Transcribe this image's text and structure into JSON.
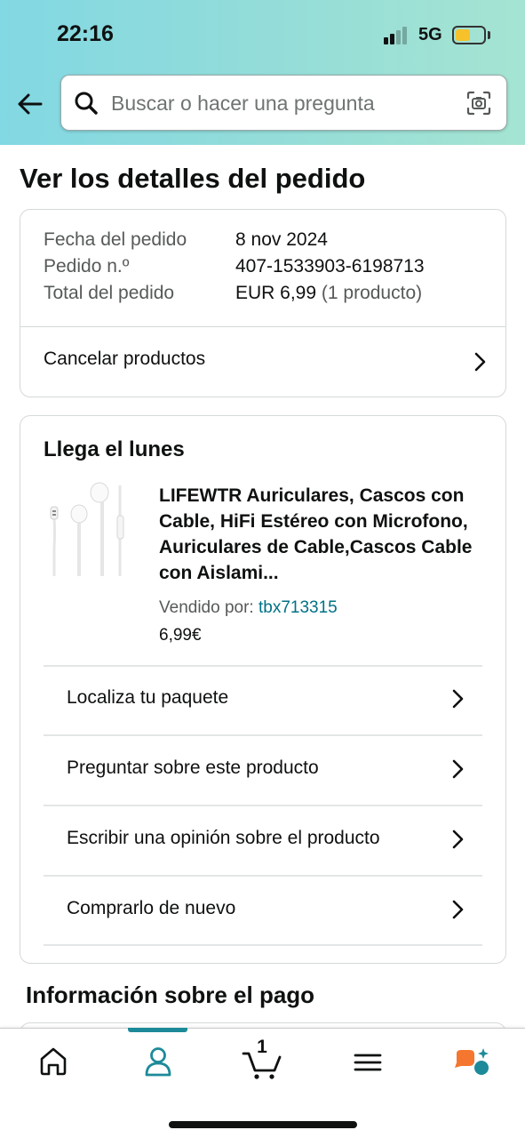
{
  "status_bar": {
    "time": "22:16",
    "network": "5G"
  },
  "search": {
    "placeholder": "Buscar o hacer una pregunta"
  },
  "page_title": "Ver los detalles del pedido",
  "order_summary": {
    "rows": [
      {
        "label": "Fecha del pedido",
        "value": "8 nov 2024",
        "extra": ""
      },
      {
        "label": "Pedido n.º",
        "value": "407-1533903-6198713",
        "extra": ""
      },
      {
        "label": "Total del pedido",
        "value": "EUR 6,99",
        "extra": "(1 producto)"
      }
    ],
    "cancel_label": "Cancelar productos"
  },
  "shipment": {
    "title": "Llega el lunes",
    "product": {
      "title": "LIFEWTR Auriculares, Cascos con Cable, HiFi Estéreo con Microfono, Auriculares de Cable,Cascos Cable con Aislami...",
      "seller_prefix": "Vendido por:",
      "seller_name": "tbx713315",
      "price": "6,99€"
    },
    "actions": [
      {
        "label": "Localiza tu paquete"
      },
      {
        "label": "Preguntar sobre este producto"
      },
      {
        "label": "Escribir una opinión sobre el producto"
      },
      {
        "label": "Comprarlo de nuevo"
      }
    ]
  },
  "payment_title": "Información sobre el pago",
  "bottom_nav": {
    "cart_count": "1",
    "items": [
      "home-icon",
      "account-icon",
      "cart-icon",
      "menu-icon",
      "rufus-icon"
    ],
    "active": "account-icon"
  },
  "colors": {
    "accent": "#1d8a99",
    "link": "#007185",
    "header_gradient_start": "#82d8e3",
    "header_gradient_end": "#a5e4d2",
    "rufus_orange": "#f5762f"
  }
}
